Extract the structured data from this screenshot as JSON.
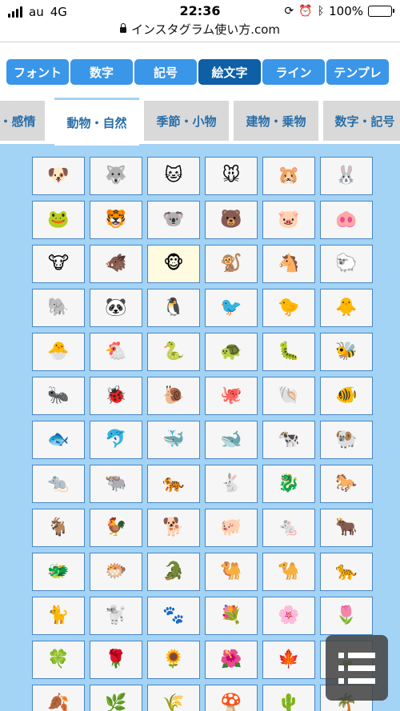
{
  "status_bar": {
    "carrier": "au",
    "network": "4G",
    "time": "22:36",
    "battery_percent": "100%"
  },
  "url_bar": {
    "url": "インスタグラム使い方.com"
  },
  "category_tabs": [
    {
      "label": "フォント",
      "active": false
    },
    {
      "label": "数字",
      "active": false
    },
    {
      "label": "記号",
      "active": false
    },
    {
      "label": "絵文字",
      "active": true
    },
    {
      "label": "ライン",
      "active": false
    },
    {
      "label": "テンプレ",
      "active": false
    }
  ],
  "sub_tabs": [
    {
      "label": "・感情",
      "active": false
    },
    {
      "label": "動物・自然",
      "active": true
    },
    {
      "label": "季節・小物",
      "active": false
    },
    {
      "label": "建物・乗物",
      "active": false
    },
    {
      "label": "数字・記号",
      "active": false
    }
  ],
  "emoji_grid": {
    "cells": [
      "🐶",
      "🐺",
      "🐱",
      "🐭",
      "🐹",
      "🐰",
      "🐸",
      "🐯",
      "🐨",
      "🐻",
      "🐷",
      "🐽",
      "🐮",
      "🐗",
      "🐵",
      "🐒",
      "🐴",
      "🐑",
      "🐘",
      "🐼",
      "🐧",
      "🐦",
      "🐤",
      "🐥",
      "🐣",
      "🐔",
      "🐍",
      "🐢",
      "🐛",
      "🐝",
      "🐜",
      "🐞",
      "🐌",
      "🐙",
      "🐚",
      "🐠",
      "🐟",
      "🐬",
      "🐳",
      "🐋",
      "🐄",
      "🐏",
      "🐀",
      "🐃",
      "🐅",
      "🐇",
      "🐉",
      "🐎",
      "🐐",
      "🐓",
      "🐕",
      "🐖",
      "🐁",
      "🐂",
      "🐲",
      "🐡",
      "🐊",
      "🐫",
      "🐪",
      "🐆",
      "🐈",
      "🐩",
      "🐾",
      "💐",
      "🌸",
      "🌷",
      "🍀",
      "🌹",
      "🌻",
      "🌺",
      "🍁",
      "🍃",
      "🍂",
      "🌿",
      "🌾",
      "🍄",
      "🌵",
      "🌴"
    ],
    "selected_index": 14
  },
  "colors": {
    "tab_blue": "#3a96e8",
    "tab_active": "#0e5fa6",
    "grid_background": "#a3d3f5",
    "cell_border": "#4a86c5"
  }
}
